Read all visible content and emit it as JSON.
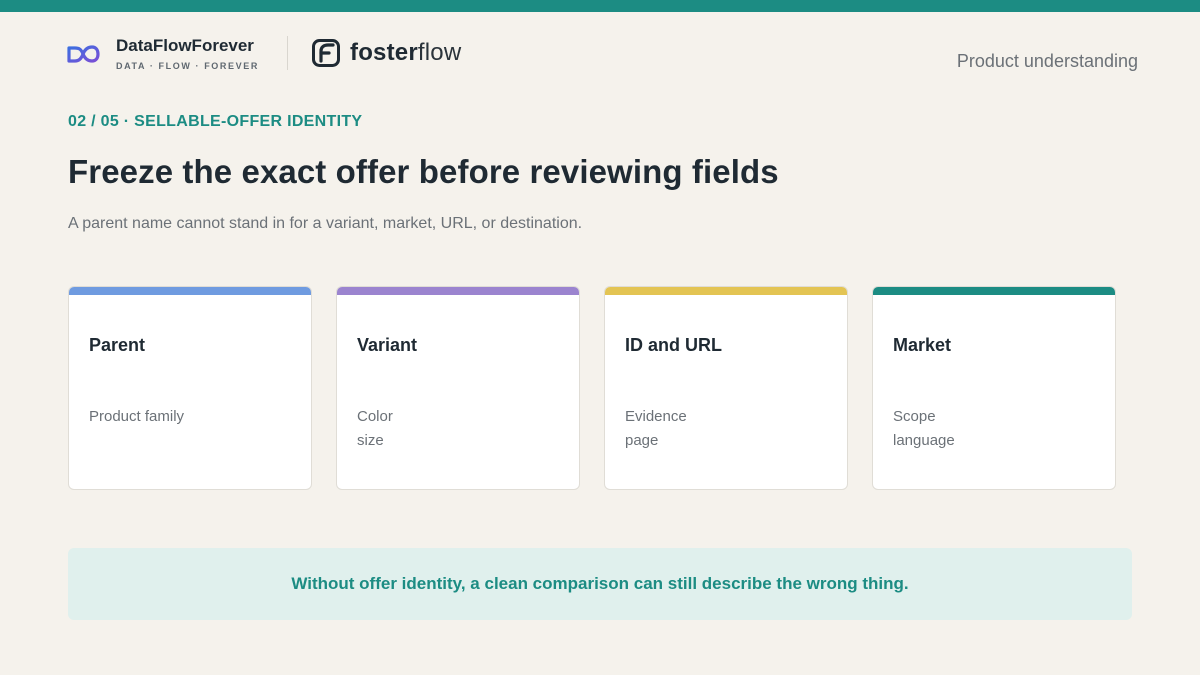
{
  "colors": {
    "top_bar": "#1c8c83",
    "accent_teal": "#1c8c83",
    "background": "#f5f2ec",
    "callout_bg": "#e0f0ed"
  },
  "header": {
    "brand_primary": {
      "name": "DataFlowForever",
      "tagline": "DATA · FLOW · FOREVER",
      "icon": "infinity-logo-icon"
    },
    "brand_secondary": {
      "name_bold": "foster",
      "name_light": "flow",
      "icon": "fosterflow-logo-icon"
    },
    "section_label": "Product understanding"
  },
  "slide": {
    "eyebrow": "02 / 05 · SELLABLE-OFFER IDENTITY",
    "title": "Freeze the exact offer before reviewing fields",
    "subtitle": "A parent name cannot stand in for a variant, market, URL, or destination."
  },
  "cards": [
    {
      "title": "Parent",
      "lines": [
        "Product family"
      ],
      "accent": "#6f9be0"
    },
    {
      "title": "Variant",
      "lines": [
        "Color",
        "size"
      ],
      "accent": "#9b84cf"
    },
    {
      "title": "ID and URL",
      "lines": [
        "Evidence",
        "page"
      ],
      "accent": "#e3c453"
    },
    {
      "title": "Market",
      "lines": [
        "Scope",
        "language"
      ],
      "accent": "#1c8c83"
    }
  ],
  "callout": {
    "text": "Without offer identity, a clean comparison can still describe the wrong thing."
  }
}
